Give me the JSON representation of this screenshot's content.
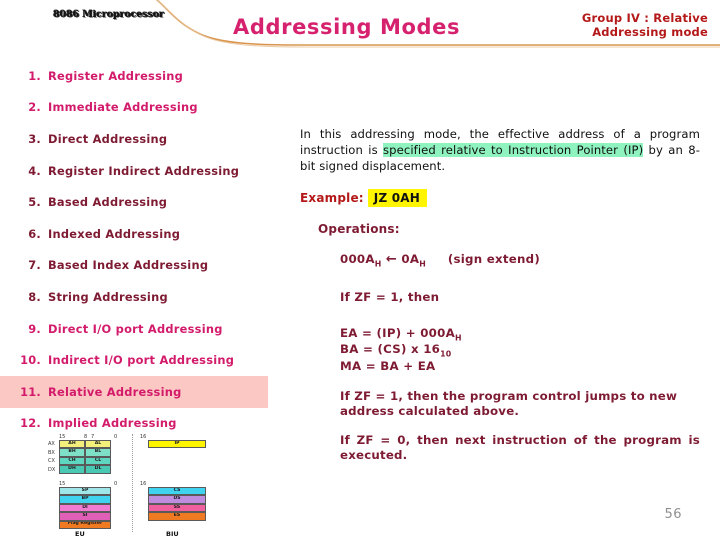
{
  "header": {
    "logo": "8086 Microprocessor",
    "title": "Addressing Modes",
    "group_line1": "Group IV : Relative",
    "group_line2": "Addressing mode",
    "accent_swoosh_color": "#D9954F",
    "title_color": "#D6216E",
    "group_color": "#B41818"
  },
  "modes": [
    {
      "num": "1.",
      "label": "Register Addressing",
      "color": "pink",
      "highlight": false
    },
    {
      "num": "2.",
      "label": "Immediate Addressing",
      "color": "pink",
      "highlight": false
    },
    {
      "num": "3.",
      "label": "Direct Addressing",
      "color": "maroon",
      "highlight": false
    },
    {
      "num": "4.",
      "label": "Register Indirect Addressing",
      "color": "maroon",
      "highlight": false
    },
    {
      "num": "5.",
      "label": "Based Addressing",
      "color": "maroon",
      "highlight": false
    },
    {
      "num": "6.",
      "label": "Indexed Addressing",
      "color": "maroon",
      "highlight": false
    },
    {
      "num": "7.",
      "label": "Based Index Addressing",
      "color": "maroon",
      "highlight": false
    },
    {
      "num": "8.",
      "label": "String Addressing",
      "color": "maroon",
      "highlight": false
    },
    {
      "num": "9.",
      "label": "Direct I/O port Addressing",
      "color": "pink",
      "highlight": false
    },
    {
      "num": "10.",
      "label": "Indirect I/O port Addressing",
      "color": "pink",
      "highlight": false
    },
    {
      "num": "11.",
      "label": "Relative Addressing",
      "color": "pink",
      "highlight": true
    },
    {
      "num": "12.",
      "label": "Implied Addressing",
      "color": "pink",
      "highlight": false
    }
  ],
  "highlight_colors": {
    "list_row": "#FBC8C3",
    "text_green": "#8FF3C0",
    "code_yellow": "#FFF500"
  },
  "content": {
    "intro_part1": "In this addressing mode, the effective address of a program instruction is ",
    "intro_highlight": "specified relative to Instruction Pointer (IP)",
    "intro_part2": " by an 8-bit signed displacement.",
    "example_label": "Example:",
    "example_code": "JZ 0AH",
    "operations_title": "Operations:",
    "op_signextend_value": "000A",
    "op_signextend_sub1": "H",
    "op_signextend_arrow": "←",
    "op_signextend_src": "0A",
    "op_signextend_sub2": "H",
    "op_signextend_note": "(sign extend)",
    "op_condition": "If ZF = 1, then",
    "op_ea_prefix": "EA = (IP) + 000A",
    "op_ea_sub": "H",
    "op_ba_prefix": "BA = (CS) x 16",
    "op_ba_sub": "10",
    "op_ma": "MA = BA + EA",
    "note_zf1": "If ZF = 1, then the program control jumps to new address calculated above.",
    "note_zf0": "If ZF = 0, then next instruction of the program is executed."
  },
  "diagram": {
    "eu_label": "EU",
    "biu_label": "BIU",
    "gp_bits_left": "15",
    "gp_bits_mid_a": "8",
    "gp_bits_mid_b": "7",
    "gp_bits_right": "0",
    "ptr_bits_left": "15",
    "ptr_bits_right": "0",
    "biu_bits_left": "16",
    "general_registers": [
      {
        "name": "AX",
        "hi": "AH",
        "lo": "AL",
        "color": "#F2F07A"
      },
      {
        "name": "BX",
        "hi": "BH",
        "lo": "BL",
        "color": "#7FE0C8"
      },
      {
        "name": "CX",
        "hi": "CH",
        "lo": "CL",
        "color": "#5FD6C0"
      },
      {
        "name": "DX",
        "hi": "DH",
        "lo": "DL",
        "color": "#49C9B4"
      }
    ],
    "pointer_registers": [
      {
        "name": "SP",
        "color": "#9FE6E8"
      },
      {
        "name": "BP",
        "color": "#3FD3EF"
      },
      {
        "name": "DI",
        "color": "#F07BD0"
      },
      {
        "name": "SI",
        "color": "#E060B8"
      },
      {
        "name": "Flag Register",
        "color": "#F07A22"
      }
    ],
    "segment_registers": [
      {
        "name": "CS",
        "color": "#3FD3EF"
      },
      {
        "name": "DS",
        "color": "#C08CE0"
      },
      {
        "name": "SS",
        "color": "#F0609F"
      },
      {
        "name": "ES",
        "color": "#F07A22"
      }
    ],
    "ip_register": {
      "name": "IP",
      "color": "#FFF500"
    }
  },
  "page_number": "56"
}
